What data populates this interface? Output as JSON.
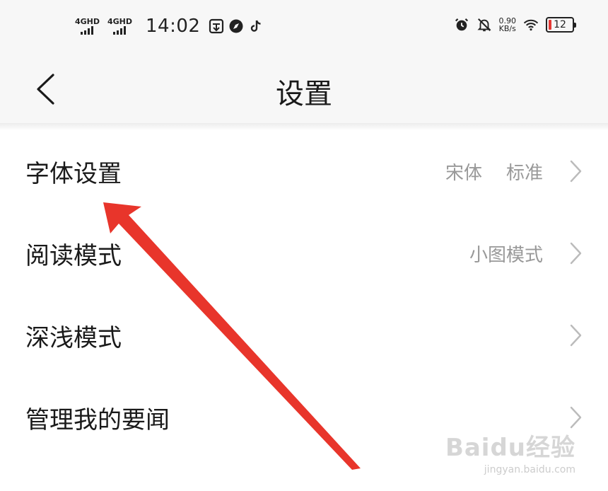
{
  "status_bar": {
    "network1": "4GHD",
    "network2": "4GHD",
    "time": "14:02",
    "speed_value": "0.90",
    "speed_unit": "KB/s",
    "battery": "12",
    "battery_level_percent": 12,
    "battery_color": "#e53935"
  },
  "header": {
    "title": "设置",
    "back_icon": "chevron-left-icon"
  },
  "settings": [
    {
      "label": "字体设置",
      "values": [
        "宋体",
        "标准"
      ]
    },
    {
      "label": "阅读模式",
      "values": [
        "小图模式"
      ]
    },
    {
      "label": "深浅模式",
      "values": []
    },
    {
      "label": "管理我的要闻",
      "values": []
    }
  ],
  "annotation": {
    "arrow_color": "#e8352b"
  },
  "watermark": {
    "main": "Baidu经验",
    "sub": "jingyan.baidu.com"
  }
}
